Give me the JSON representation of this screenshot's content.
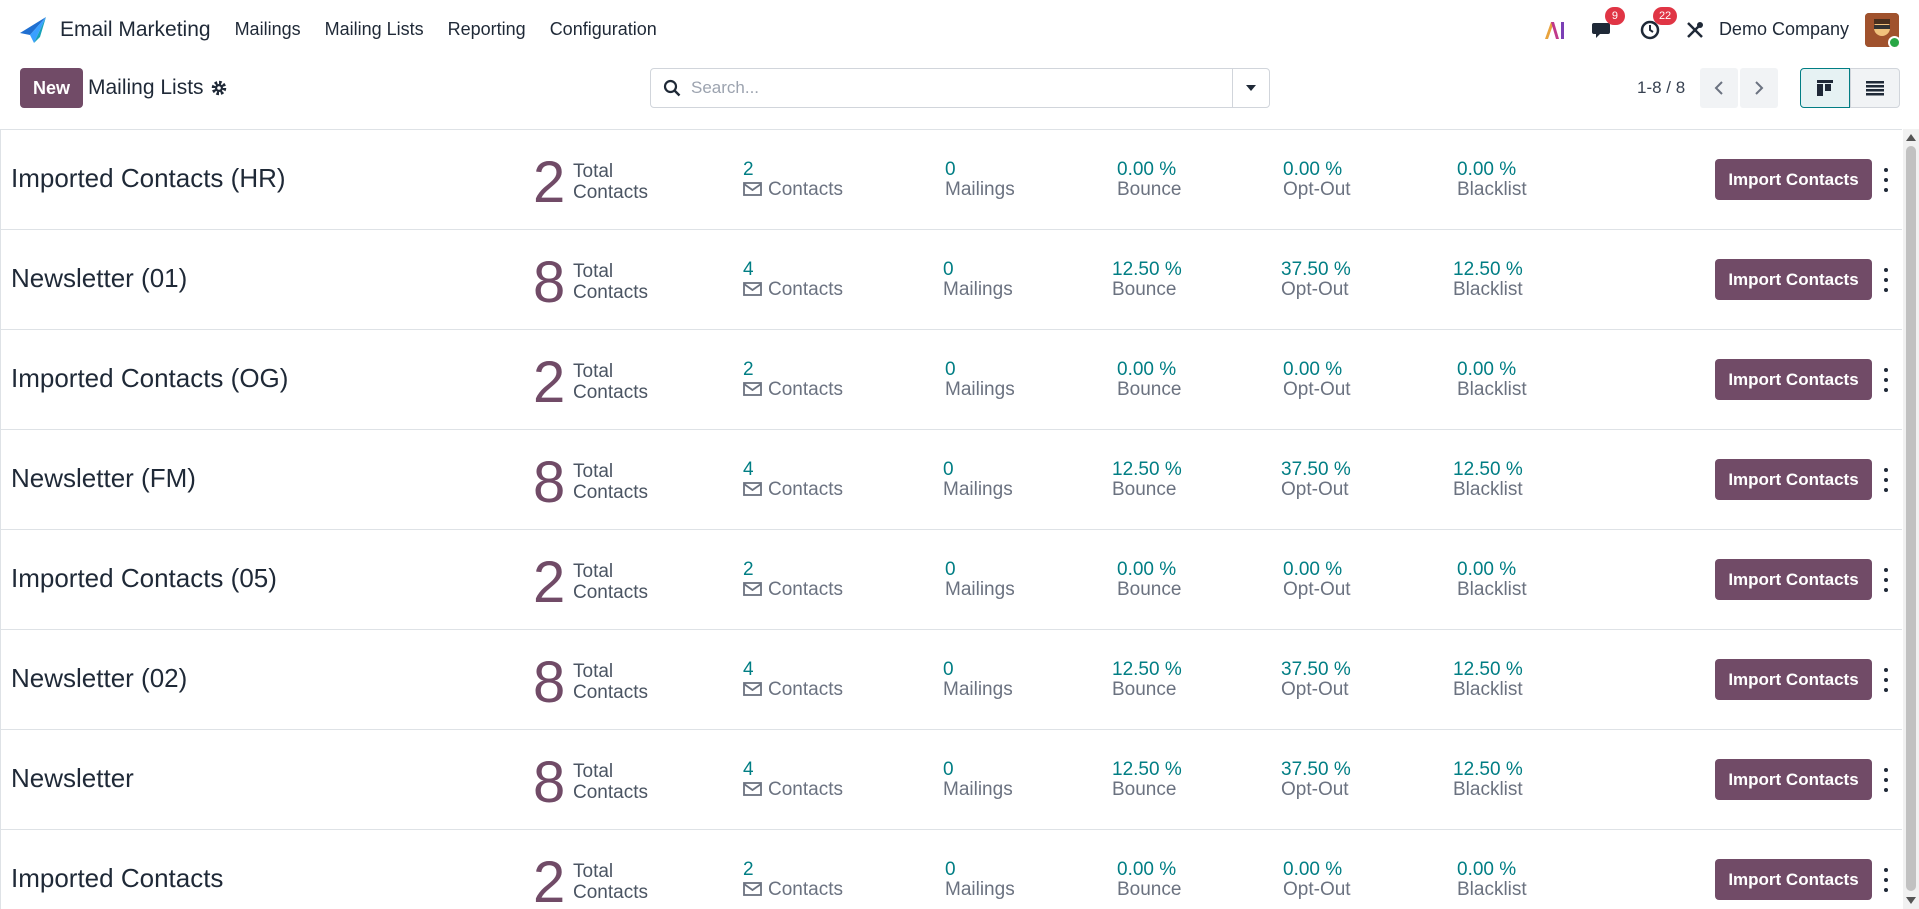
{
  "navbar": {
    "app_name": "Email Marketing",
    "menu": [
      "Mailings",
      "Mailing Lists",
      "Reporting",
      "Configuration"
    ],
    "messages_count": "9",
    "activities_count": "22",
    "company": "Demo Company"
  },
  "control": {
    "new_label": "New",
    "title": "Mailing Lists",
    "search_placeholder": "Search...",
    "pager": "1-8 / 8"
  },
  "labels": {
    "total_1": "Total",
    "total_2": "Contacts",
    "contacts": "Contacts",
    "mailings": "Mailings",
    "bounce": "Bounce",
    "optout": "Opt-Out",
    "blacklist": "Blacklist",
    "import": "Import Contacts"
  },
  "lists": [
    {
      "name": "Imported Contacts (HR)",
      "total": "2",
      "contacts": "2",
      "mailings": "0",
      "bounce": "0.00 %",
      "optout": "0.00 %",
      "blacklist": "0.00 %"
    },
    {
      "name": "Newsletter (01)",
      "total": "8",
      "contacts": "4",
      "mailings": "0",
      "bounce": "12.50 %",
      "optout": "37.50 %",
      "blacklist": "12.50 %"
    },
    {
      "name": "Imported Contacts (OG)",
      "total": "2",
      "contacts": "2",
      "mailings": "0",
      "bounce": "0.00 %",
      "optout": "0.00 %",
      "blacklist": "0.00 %"
    },
    {
      "name": "Newsletter (FM)",
      "total": "8",
      "contacts": "4",
      "mailings": "0",
      "bounce": "12.50 %",
      "optout": "37.50 %",
      "blacklist": "12.50 %"
    },
    {
      "name": "Imported Contacts (05)",
      "total": "2",
      "contacts": "2",
      "mailings": "0",
      "bounce": "0.00 %",
      "optout": "0.00 %",
      "blacklist": "0.00 %"
    },
    {
      "name": "Newsletter (02)",
      "total": "8",
      "contacts": "4",
      "mailings": "0",
      "bounce": "12.50 %",
      "optout": "37.50 %",
      "blacklist": "12.50 %"
    },
    {
      "name": "Newsletter",
      "total": "8",
      "contacts": "4",
      "mailings": "0",
      "bounce": "12.50 %",
      "optout": "37.50 %",
      "blacklist": "12.50 %"
    },
    {
      "name": "Imported Contacts",
      "total": "2",
      "contacts": "2",
      "mailings": "0",
      "bounce": "0.00 %",
      "optout": "0.00 %",
      "blacklist": "0.00 %"
    }
  ],
  "colors": {
    "brand": "#714b67",
    "accent": "#017e84",
    "badge": "#e03545"
  }
}
